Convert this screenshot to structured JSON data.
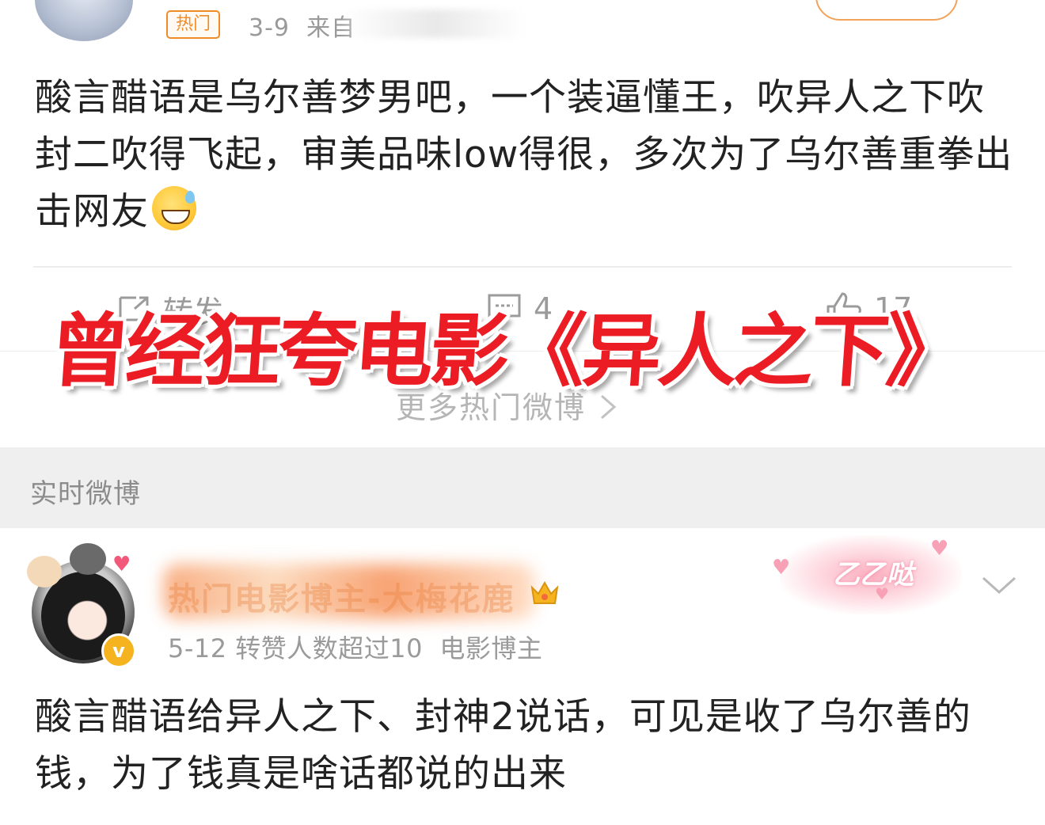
{
  "top_post": {
    "hot_badge": "热门",
    "date": "3-9",
    "source_prefix": "来自",
    "text": "酸言醋语是乌尔善梦男吧，一个装逼懂王，吹异人之下吹封二吹得飞起，审美品味low得很，多次为了乌尔善重拳出击网友",
    "emoji_icon": "sweat-smile-emoji"
  },
  "actions": {
    "repost_label": "转发",
    "comment_count": "4",
    "like_count": "17"
  },
  "more_link": "更多热门微博",
  "overlay_title": "曾经狂夸电影《异人之下》",
  "section": {
    "title": "实时微博"
  },
  "second_post": {
    "username": "热门电影博主-大梅花鹿",
    "date": "5-12",
    "repost_note": "转赞人数超过10",
    "role": "电影博主",
    "decoration_text": "乙乙哒",
    "verified_badge": "v",
    "text": "酸言醋语给异人之下、封神2说话，可见是收了乌尔善的钱，为了钱真是啥话都说的出来"
  },
  "colors": {
    "accent_orange": "#f08c28",
    "overlay_red": "#ec1c24",
    "meta_gray": "#9a9a9a"
  }
}
